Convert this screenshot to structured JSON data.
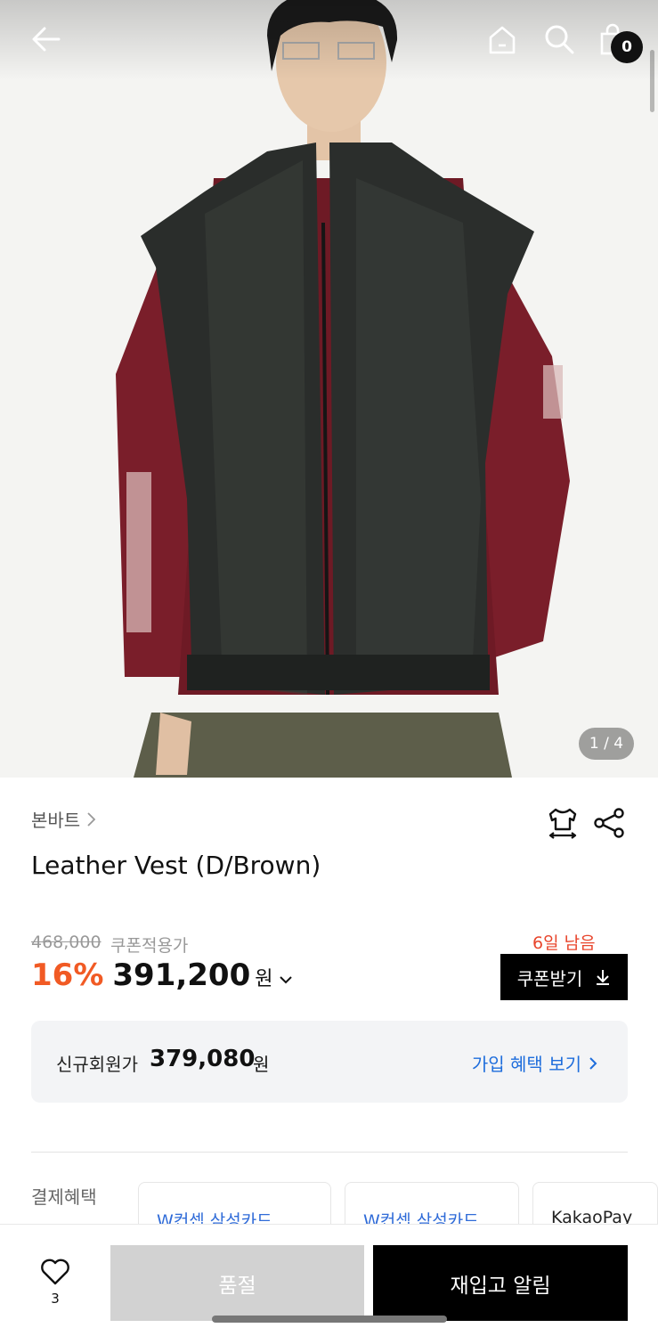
{
  "header": {
    "back_icon": "arrow-left-icon",
    "home_icon": "home-icon",
    "search_icon": "search-icon",
    "cart_icon": "shopping-bag-icon",
    "cart_count": "0"
  },
  "gallery": {
    "image_alt": "Model wearing distressed black leather vest over burgundy long sleeve tee",
    "page_indicator": "1 / 4"
  },
  "product": {
    "brand": "본바트",
    "title": "Leather Vest (D/Brown)",
    "original_price": "468,000",
    "coupon_price_label": "쿠폰적용가",
    "discount": "16%",
    "price": "391,200",
    "currency": "원",
    "days_left": "6일 남음",
    "coupon_button": "쿠폰받기"
  },
  "member": {
    "label": "신규회원가",
    "price": "379,080",
    "currency": "원",
    "link": "가입 혜택 보기"
  },
  "payment": {
    "label": "결제혜택",
    "cards": [
      "W컨셉 삼성카드",
      "W컨셉 삼성카드",
      "KakaoPay"
    ]
  },
  "bottom": {
    "like_count": "3",
    "soldout_label": "품절",
    "restock_label": "재입고 알림"
  },
  "colors": {
    "accent_discount": "#f15a24",
    "link_blue": "#1e6ddc",
    "days_red": "#e8452c"
  }
}
